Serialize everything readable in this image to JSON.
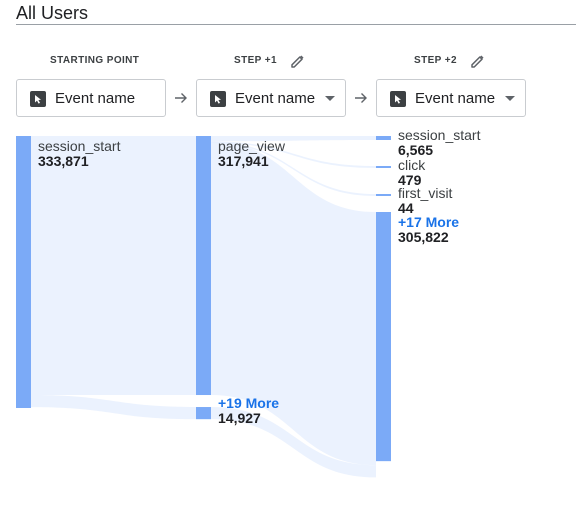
{
  "segment": "All Users",
  "steps": [
    {
      "header": "STARTING POINT",
      "dimension": "Event name",
      "editable": false
    },
    {
      "header": "STEP +1",
      "dimension": "Event name",
      "editable": true
    },
    {
      "header": "STEP +2",
      "dimension": "Event name",
      "editable": true
    }
  ],
  "icons": {
    "step_edit": "pencil-icon",
    "dimension": "cursor-select-icon",
    "dropdown": "caret-down-icon",
    "between_steps": "arrow-right-icon"
  },
  "colors": {
    "node": "#7baaf7",
    "flow": "#e8f0fe",
    "more_link": "#1a73e8"
  },
  "chart_data": {
    "type": "sankey",
    "columns": [
      "STARTING POINT",
      "STEP +1",
      "STEP +2"
    ],
    "nodes": [
      {
        "id": "s0_session_start",
        "column": 0,
        "label": "session_start",
        "value": 333871,
        "value_text": "333,871"
      },
      {
        "id": "s1_page_view",
        "column": 1,
        "label": "page_view",
        "value": 317941,
        "value_text": "317,941"
      },
      {
        "id": "s1_more",
        "column": 1,
        "label": "+19 More",
        "value": 14927,
        "value_text": "14,927",
        "more": true
      },
      {
        "id": "s2_session_start",
        "column": 2,
        "label": "session_start",
        "value": 6565,
        "value_text": "6,565"
      },
      {
        "id": "s2_click",
        "column": 2,
        "label": "click",
        "value": 479,
        "value_text": "479"
      },
      {
        "id": "s2_first_visit",
        "column": 2,
        "label": "first_visit",
        "value": 44,
        "value_text": "44"
      },
      {
        "id": "s2_more",
        "column": 2,
        "label": "+17 More",
        "value": 305822,
        "value_text": "305,822",
        "more": true
      }
    ],
    "links": [
      {
        "source": "s0_session_start",
        "target": "s1_page_view",
        "value": 317941
      },
      {
        "source": "s0_session_start",
        "target": "s1_more",
        "value": 14927
      },
      {
        "source": "s1_page_view",
        "target": "s2_session_start",
        "value": 6565
      },
      {
        "source": "s1_page_view",
        "target": "s2_click",
        "value": 479
      },
      {
        "source": "s1_page_view",
        "target": "s2_first_visit",
        "value": 44
      },
      {
        "source": "s1_page_view",
        "target": "s2_more",
        "value": 310853
      },
      {
        "source": "s1_more",
        "target": "s2_more",
        "value": 14927
      }
    ]
  }
}
